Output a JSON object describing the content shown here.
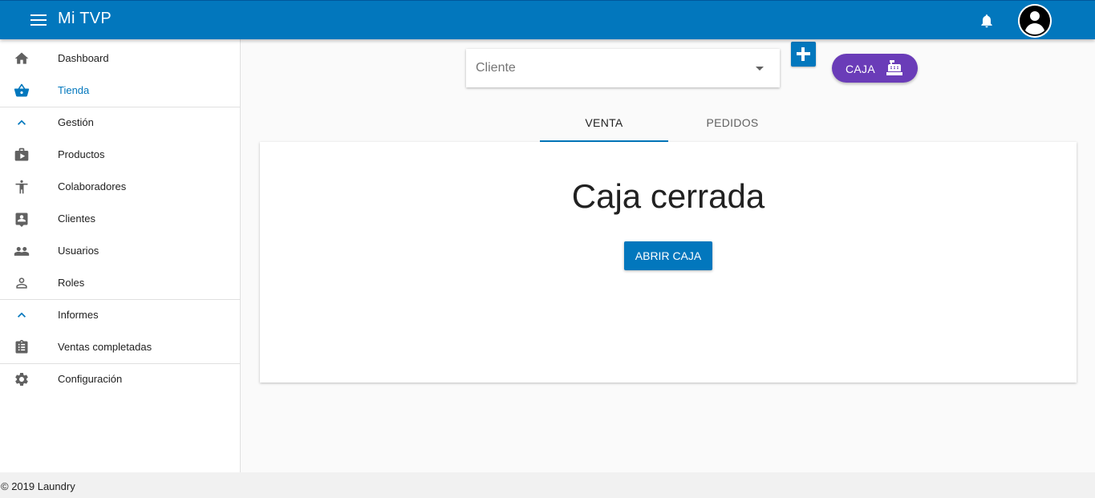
{
  "app": {
    "title": "Mi TVP"
  },
  "header": {
    "menu_icon": "menu-icon",
    "notifications_icon": "bell-icon",
    "avatar_icon": "account-circle-icon"
  },
  "sidebar": {
    "items": [
      {
        "label": "Dashboard",
        "icon": "home-icon"
      },
      {
        "label": "Tienda",
        "icon": "basket-icon",
        "active": true
      },
      {
        "label": "Gestión",
        "icon": "chevron-up-icon"
      },
      {
        "label": "Productos",
        "icon": "briefcase-play-icon"
      },
      {
        "label": "Colaboradores",
        "icon": "accessibility-icon"
      },
      {
        "label": "Clientes",
        "icon": "contact-icon"
      },
      {
        "label": "Usuarios",
        "icon": "people-icon"
      },
      {
        "label": "Roles",
        "icon": "person-icon"
      },
      {
        "label": "Informes",
        "icon": "chevron-up-icon"
      },
      {
        "label": "Ventas completadas",
        "icon": "clipboard-list-icon"
      },
      {
        "label": "Configuración",
        "icon": "gear-icon"
      }
    ]
  },
  "toolbar": {
    "client_placeholder": "Cliente",
    "caja_label": "CAJA",
    "caja_icon": "cash-register-icon",
    "add_icon": "plus-icon"
  },
  "tabs": [
    {
      "label": "VENTA",
      "active": true
    },
    {
      "label": "PEDIDOS",
      "active": false
    }
  ],
  "card": {
    "title": "Caja cerrada",
    "button_label": "ABRIR CAJA"
  },
  "footer": {
    "text": "© 2019 Laundry"
  },
  "colors": {
    "primary": "#0277bd",
    "caja": "#6a3cb8"
  }
}
